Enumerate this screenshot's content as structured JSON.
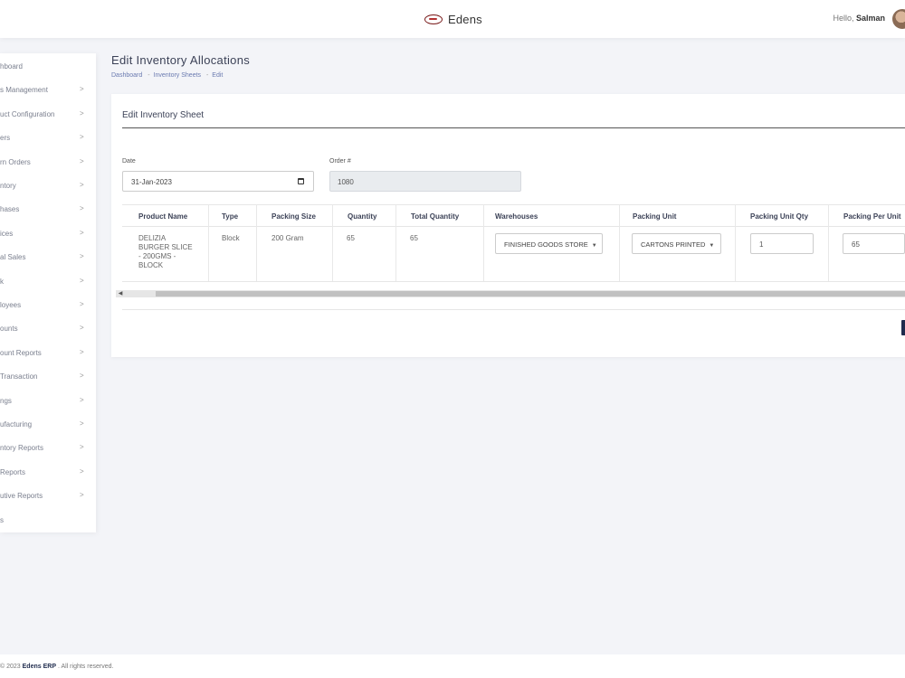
{
  "header": {
    "brand": "Edens",
    "greeting": "Hello,",
    "user": "Salman"
  },
  "sidebar": {
    "items": [
      {
        "label": "hboard",
        "has_arrow": false
      },
      {
        "label": "s Management",
        "has_arrow": true
      },
      {
        "label": "uct Configuration",
        "has_arrow": true
      },
      {
        "label": "ers",
        "has_arrow": true
      },
      {
        "label": "rn Orders",
        "has_arrow": true
      },
      {
        "label": "ntory",
        "has_arrow": true
      },
      {
        "label": "hases",
        "has_arrow": true
      },
      {
        "label": "ices",
        "has_arrow": true
      },
      {
        "label": "al Sales",
        "has_arrow": true
      },
      {
        "label": "k",
        "has_arrow": true
      },
      {
        "label": "loyees",
        "has_arrow": true
      },
      {
        "label": "ounts",
        "has_arrow": true
      },
      {
        "label": "ount Reports",
        "has_arrow": true
      },
      {
        "label": "Transaction",
        "has_arrow": true
      },
      {
        "label": "ngs",
        "has_arrow": true
      },
      {
        "label": "ufacturing",
        "has_arrow": true
      },
      {
        "label": "ntory Reports",
        "has_arrow": true
      },
      {
        "label": "Reports",
        "has_arrow": true
      },
      {
        "label": "utive Reports",
        "has_arrow": true
      },
      {
        "label": "s",
        "has_arrow": false
      }
    ],
    "arrow": ">"
  },
  "page": {
    "title": "Edit Inventory Allocations",
    "breadcrumb": [
      "Dashboard",
      "Inventory Sheets",
      "Edit"
    ],
    "breadcrumb_sep": "-"
  },
  "form": {
    "card_title": "Edit Inventory Sheet",
    "date_label": "Date",
    "date_value": "31-Jan-2023",
    "order_label": "Order #",
    "order_value": "1080"
  },
  "table": {
    "headers": [
      "Product Name",
      "Type",
      "Packing Size",
      "Quantity",
      "Total Quantity",
      "Warehouses",
      "Packing Unit",
      "Packing Unit Qty",
      "Packing Per Unit"
    ],
    "rows": [
      {
        "product_name": "DELIZIA BURGER SLICE - 200GMS - BLOCK",
        "type": "Block",
        "packing_size": "200 Gram",
        "quantity": "65",
        "total_quantity": "65",
        "warehouse": "FINISHED GOODS STORE",
        "packing_unit": "CARTONS PRINTED",
        "packing_unit_qty": "1",
        "packing_per_unit": "65"
      }
    ]
  },
  "footer": {
    "prefix": "© 2023",
    "brand": "Edens ERP",
    "suffix": ". All rights reserved."
  }
}
